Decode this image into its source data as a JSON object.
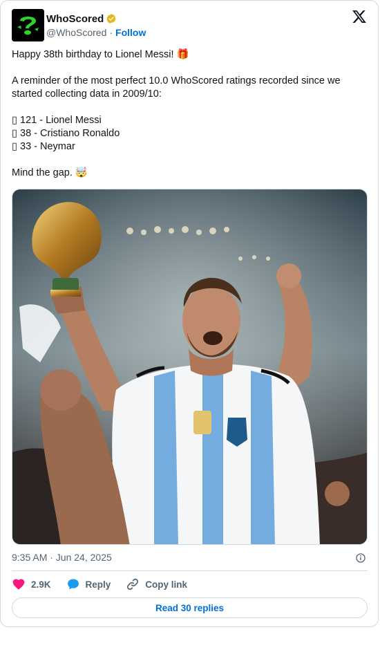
{
  "author": {
    "display_name": "WhoScored",
    "handle": "@WhoScored",
    "separator": "·",
    "follow_label": "Follow",
    "verified": true,
    "brand_color": "#000000",
    "accent_green": "#2dd42d"
  },
  "icons": {
    "verified": "verified-badge-icon",
    "platform": "x-logo-icon",
    "info": "info-icon",
    "like": "heart-icon",
    "reply": "speech-bubble-icon",
    "copy": "link-icon"
  },
  "tweet": {
    "lines": [
      "Happy 38th birthday to Lionel Messi! 🎁",
      "A reminder of the most perfect 10.0 WhoScored ratings recorded since we started collecting data in 2009/10:",
      "▯ 121 - Lionel Messi",
      "▯ 38 - Cristiano Ronaldo",
      "▯ 33 - Neymar",
      "Mind the gap. 🤯"
    ]
  },
  "timestamp": "9:35 AM · Jun 24, 2025",
  "actions": {
    "likes": "2.9K",
    "reply_label": "Reply",
    "copy_label": "Copy link",
    "like_color": "#f91880",
    "reply_color": "#1d9bf0"
  },
  "read_replies_label": "Read 30 replies",
  "link_color": "#006fd6"
}
